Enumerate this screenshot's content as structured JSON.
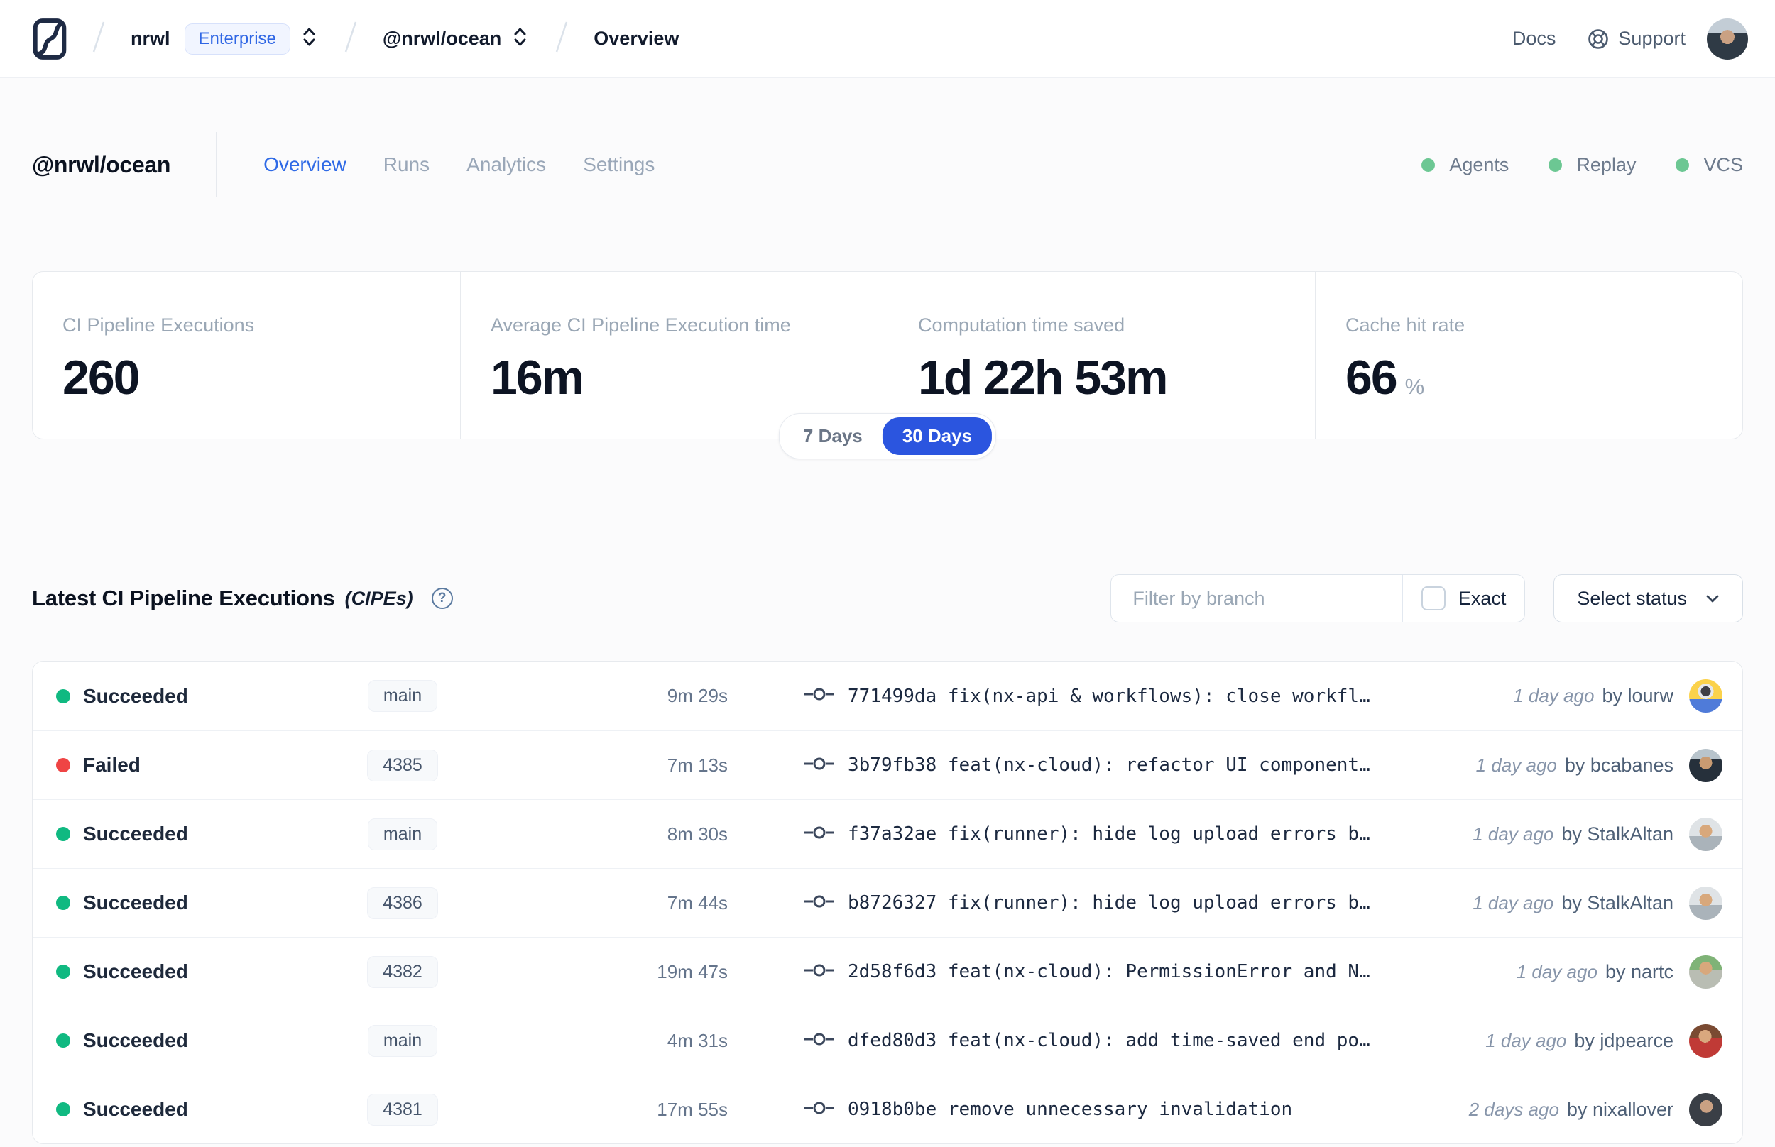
{
  "topnav": {
    "breadcrumb": {
      "org": "nrwl",
      "org_badge": "Enterprise",
      "workspace": "@nrwl/ocean",
      "page": "Overview"
    },
    "links": {
      "docs": "Docs",
      "support": "Support"
    }
  },
  "header": {
    "title": "@nrwl/ocean",
    "tabs": [
      {
        "label": "Overview",
        "active": true
      },
      {
        "label": "Runs",
        "active": false
      },
      {
        "label": "Analytics",
        "active": false
      },
      {
        "label": "Settings",
        "active": false
      }
    ],
    "statuses": [
      {
        "label": "Agents"
      },
      {
        "label": "Replay"
      },
      {
        "label": "VCS"
      }
    ]
  },
  "stats": {
    "cards": [
      {
        "label": "CI Pipeline Executions",
        "value": "260",
        "suffix": ""
      },
      {
        "label": "Average CI Pipeline Execution time",
        "value": "16m",
        "suffix": ""
      },
      {
        "label": "Computation time saved",
        "value": "1d 22h 53m",
        "suffix": ""
      },
      {
        "label": "Cache hit rate",
        "value": "66",
        "suffix": "%"
      }
    ],
    "range_toggle": {
      "options": [
        "7 Days",
        "30 Days"
      ],
      "selected": "30 Days"
    }
  },
  "cipes": {
    "title": "Latest CI Pipeline Executions",
    "title_suffix": "(CIPEs)",
    "help_glyph": "?",
    "filter": {
      "placeholder": "Filter by branch",
      "exact_label": "Exact",
      "exact_checked": false,
      "status_label": "Select status"
    },
    "rows": [
      {
        "status": "Succeeded",
        "branch": "main",
        "duration": "9m 29s",
        "commit": "771499da fix(nx-api & workflows): close workfl…",
        "time": "1 day ago",
        "author": "by lourw",
        "dot_style": "background:#10b981",
        "avatar_style": "background:radial-gradient(circle 7px at 50% 36%,#3f3f46 99%,transparent),radial-gradient(circle 11px at 50% 36%,#e5e7eb 99%,transparent),linear-gradient(180deg,#fbd24b 0 60%,#4f7bd9 60%)"
      },
      {
        "status": "Failed",
        "branch": "4385",
        "duration": "7m 13s",
        "commit": "3b79fb38 feat(nx-cloud): refactor UI component…",
        "time": "1 day ago",
        "author": "by bcabanes",
        "dot_style": "background:#ef4444",
        "avatar_style": "background:radial-gradient(circle 9px at 50% 42%,#c99b72 99%,transparent),linear-gradient(180deg,#b8c4cc 0 32%,#26303b 32%)"
      },
      {
        "status": "Succeeded",
        "branch": "main",
        "duration": "8m 30s",
        "commit": "f37a32ae fix(runner): hide log upload errors b…",
        "time": "1 day ago",
        "author": "by StalkAltan",
        "dot_style": "background:#10b981",
        "avatar_style": "background:radial-gradient(circle 9px at 50% 40%,#d8a87c 99%,transparent),linear-gradient(180deg,#dfe3e6 0 55%,#aab3ba 55%)"
      },
      {
        "status": "Succeeded",
        "branch": "4386",
        "duration": "7m 44s",
        "commit": "b8726327 fix(runner): hide log upload errors b…",
        "time": "1 day ago",
        "author": "by StalkAltan",
        "dot_style": "background:#10b981",
        "avatar_style": "background:radial-gradient(circle 9px at 50% 40%,#d8a87c 99%,transparent),linear-gradient(180deg,#dfe3e6 0 55%,#aab3ba 55%)"
      },
      {
        "status": "Succeeded",
        "branch": "4382",
        "duration": "19m 47s",
        "commit": "2d58f6d3 feat(nx-cloud): PermissionError and N…",
        "time": "1 day ago",
        "author": "by nartc",
        "dot_style": "background:#10b981",
        "avatar_style": "background:radial-gradient(circle 9px at 50% 38%,#d8a87c 99%,transparent),linear-gradient(180deg,#7fb377 0 45%,#b9bdb3 45%)"
      },
      {
        "status": "Succeeded",
        "branch": "main",
        "duration": "4m 31s",
        "commit": "dfed80d3 feat(nx-cloud): add time-saved end po…",
        "time": "1 day ago",
        "author": "by jdpearce",
        "dot_style": "background:#10b981",
        "avatar_style": "background:radial-gradient(circle 9px at 48% 36%,#d9a87e 99%,transparent),linear-gradient(180deg,#7a4a32 0 40%,#c03a36 40%)"
      },
      {
        "status": "Succeeded",
        "branch": "4381",
        "duration": "17m 55s",
        "commit": "0918b0be remove unnecessary invalidation",
        "time": "2 days ago",
        "author": "by nixallover",
        "dot_style": "background:#10b981",
        "avatar_style": "background:radial-gradient(circle 9px at 52% 40%,#caa183 99%,transparent),linear-gradient(180deg,#3a3f46 0 100%)"
      }
    ]
  },
  "avatars": {
    "topbar_style": "background:radial-gradient(circle 10px at 50% 45%,#caa183 99%,transparent),linear-gradient(180deg,#c3cdd6 0 35%,#2f3a45 35%)"
  },
  "colors": {
    "accent_blue": "#2f6ae6",
    "pill_blue": "#2b55df",
    "success_green": "#10b981",
    "failed_red": "#ef4444",
    "header_status_green": "#6cc793"
  }
}
